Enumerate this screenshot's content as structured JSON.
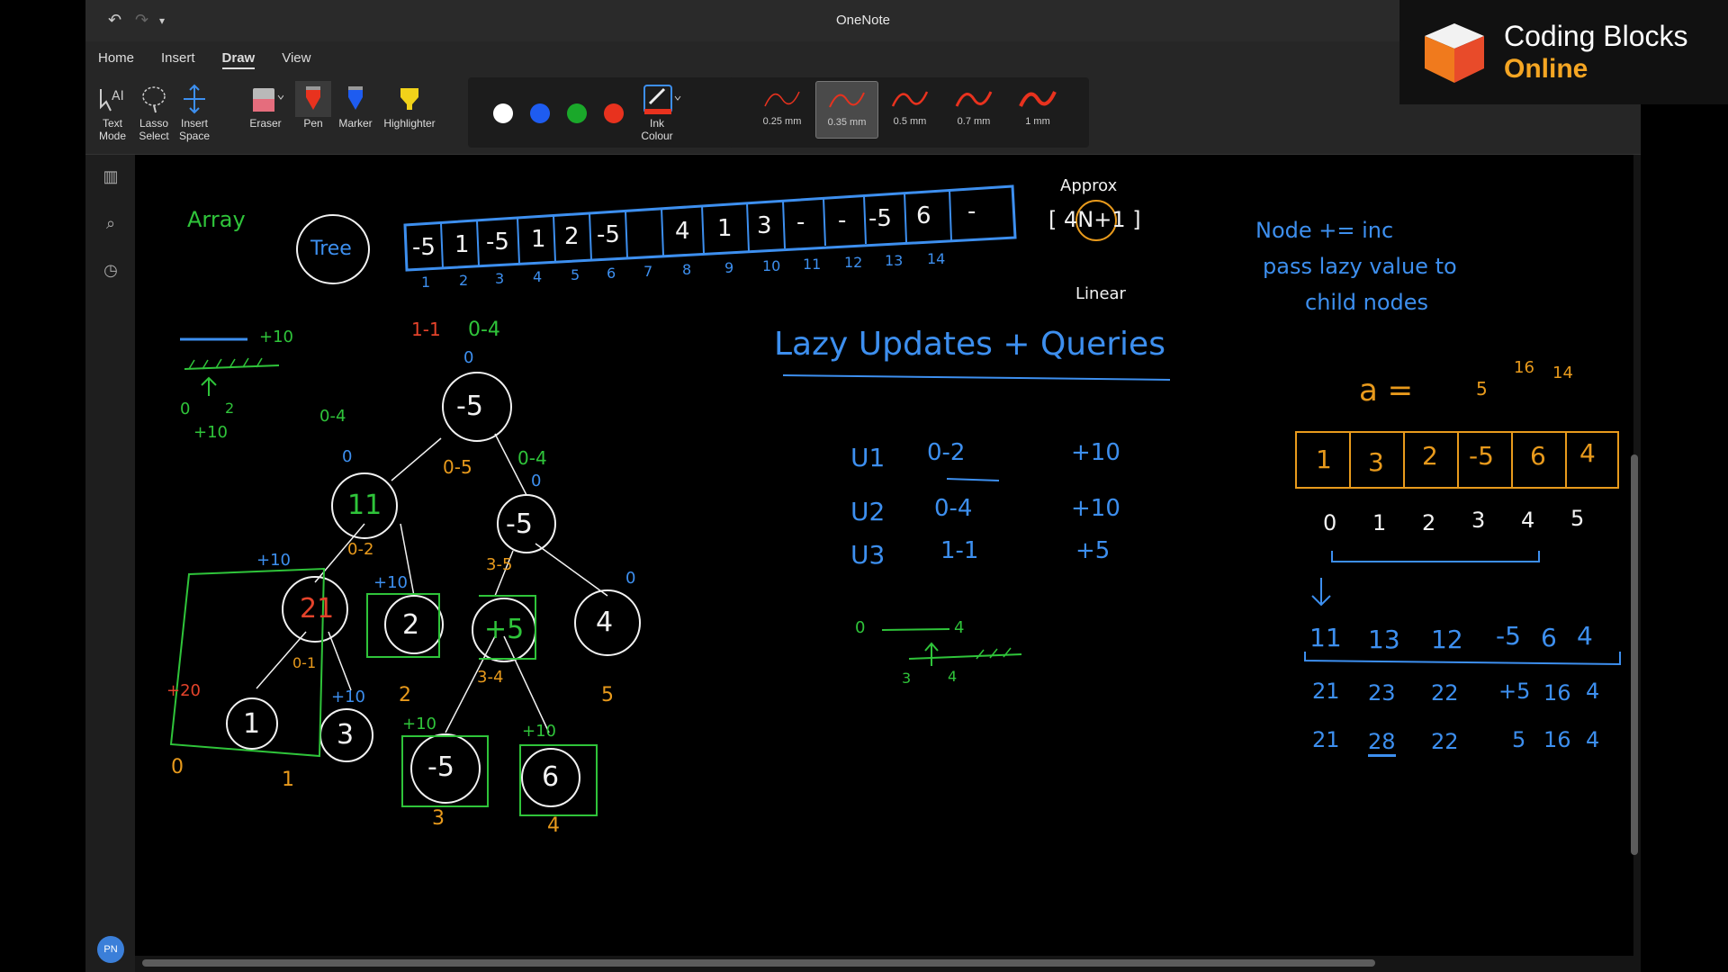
{
  "window": {
    "title": "OneNote"
  },
  "ribbon": {
    "tabs": [
      {
        "label": "Home"
      },
      {
        "label": "Insert"
      },
      {
        "label": "Draw"
      },
      {
        "label": "View"
      }
    ],
    "active_tab": "Draw",
    "tools": {
      "text_mode": "Text Mode",
      "lasso": "Lasso Select",
      "insert_space": "Insert Space",
      "eraser": "Eraser",
      "pen": "Pen",
      "marker": "Marker",
      "highlighter": "Highlighter",
      "ink_colour": "Ink Colour"
    },
    "colors": [
      "#ffffff",
      "#1e5cf0",
      "#1aa82a",
      "#e8321e"
    ],
    "thickness": [
      {
        "label": "0.25 mm",
        "selected": false
      },
      {
        "label": "0.35 mm",
        "selected": true
      },
      {
        "label": "0.5 mm",
        "selected": false
      },
      {
        "label": "0.7 mm",
        "selected": false
      },
      {
        "label": "1 mm",
        "selected": false
      }
    ]
  },
  "sidebar": {
    "icons": [
      "notebooks-icon",
      "search-icon",
      "history-icon"
    ],
    "avatar": "PN"
  },
  "brand": {
    "line1": "Coding Blocks",
    "line2": "Online"
  },
  "notes": {
    "array_label": "Array",
    "tree_label": "Tree",
    "array_values": [
      "-5",
      "1",
      "-5",
      "1",
      "2",
      "-5",
      "4",
      "1",
      "3",
      "-",
      "-",
      "-5",
      "6",
      "-"
    ],
    "array_indices": [
      "1",
      "2",
      "3",
      "4",
      "5",
      "6",
      "7",
      "8",
      "9",
      "10",
      "11",
      "12",
      "13",
      "14"
    ],
    "approx": "Approx",
    "approx_formula": "[ 4N+1 ]",
    "linear": "Linear",
    "heading": "Lazy Updates + Queries",
    "node_note_1": "Node += inc",
    "node_note_2": "pass lazy value to",
    "node_note_3": "child nodes",
    "a_label": "a =",
    "a_updates": [
      "5",
      "16",
      "14"
    ],
    "a_values": [
      "1",
      "3",
      "2",
      "-5",
      "6",
      "4"
    ],
    "a_indices": [
      "0",
      "1",
      "2",
      "3",
      "4",
      "5"
    ],
    "a_row1": [
      "11",
      "13",
      "12",
      "-5",
      "6",
      "4"
    ],
    "a_row2": [
      "21",
      "23",
      "22",
      "+5",
      "16",
      "4"
    ],
    "a_row3": [
      "21",
      "28",
      "22",
      "5",
      "16",
      "4"
    ],
    "updates": [
      {
        "id": "U1",
        "range": "0-2",
        "inc": "+10"
      },
      {
        "id": "U2",
        "range": "0-4",
        "inc": "+10"
      },
      {
        "id": "U3",
        "range": "1-1",
        "inc": "+5"
      }
    ],
    "mini_line": {
      "left": "0",
      "right": "4",
      "bottom_left": "3",
      "bottom_right": "4"
    },
    "legend_inc": "+10",
    "legend_lazy": "0",
    "legend_lazy_plus": "+10",
    "legend_ticks": "2",
    "tree": {
      "root": "-5",
      "root_lazy": "0",
      "root_range_top": "1-1",
      "root_range_top2": "0-4",
      "left": "11",
      "left_lazy": "0",
      "right": "-5",
      "right_lazy": "0",
      "left_left": "21",
      "left_right": "2",
      "right_left": "+5",
      "right_right": "4",
      "leaf0": "1",
      "leaf1": "3",
      "leaf3": "-5",
      "leaf4": "6",
      "idx0": "0",
      "idx1": "1",
      "idx2": "2",
      "idx3": "3",
      "idx4": "4",
      "idx5": "5",
      "range_0_4": "0-4",
      "range_0_5": "0-5",
      "range_0_4b": "0-4",
      "range_0_2": "0-2",
      "range_3_5": "3-5",
      "range_0_1": "0-1",
      "range_3_4": "3-4",
      "plus10_a": "+10",
      "plus10_b": "+10",
      "plus20": "+20",
      "plus10_c": "+10",
      "plus10_d": "+10",
      "plus10_e": "+10",
      "lazy_0_rr": "0"
    }
  }
}
